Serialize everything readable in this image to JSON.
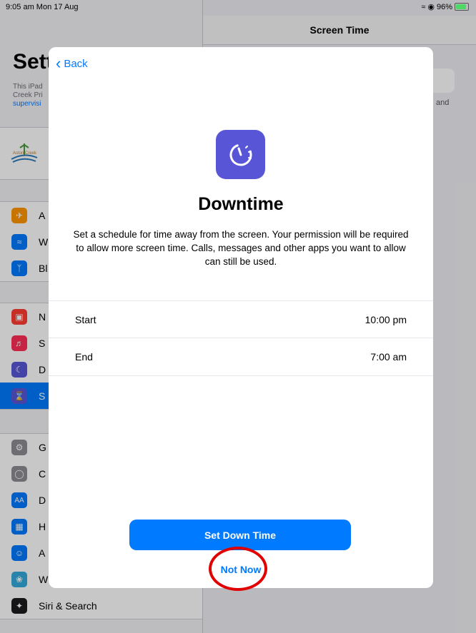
{
  "status_bar": {
    "time": "9:05 am  Mon 17 Aug",
    "battery": "96%"
  },
  "sidebar": {
    "title": "Sett",
    "subtitle_lines": [
      "This iPad",
      "Creek Pri"
    ],
    "supervised_link": "supervisi",
    "items": [
      {
        "label": "A",
        "icon": "airplane-icon",
        "color": "#ff9500"
      },
      {
        "label": "W",
        "icon": "wifi-icon",
        "color": "#007aff"
      },
      {
        "label": "Bl",
        "icon": "bluetooth-icon",
        "color": "#007aff"
      },
      {
        "label": "N",
        "icon": "notifications-icon",
        "color": "#ff3b30"
      },
      {
        "label": "S",
        "icon": "sounds-icon",
        "color": "#ff2d55"
      },
      {
        "label": "D",
        "icon": "moon-icon",
        "color": "#5856d6"
      },
      {
        "label": "S",
        "icon": "hourglass-icon",
        "color": "#5856d6"
      },
      {
        "label": "G",
        "icon": "gear-icon",
        "color": "#8e8e93"
      },
      {
        "label": "C",
        "icon": "control-centre-icon",
        "color": "#8e8e93"
      },
      {
        "label": "D",
        "icon": "display-icon",
        "color": "#007aff"
      },
      {
        "label": "H",
        "icon": "home-screen-icon",
        "color": "#007aff"
      },
      {
        "label": "A",
        "icon": "accessibility-icon",
        "color": "#007aff"
      },
      {
        "label": "W",
        "icon": "wallpaper-icon",
        "color": "#34aadc"
      },
      {
        "label": "Siri & Search",
        "icon": "siri-icon",
        "color": "#1c1c1e"
      }
    ]
  },
  "detail": {
    "title": "Screen Time",
    "snippet": "and"
  },
  "modal": {
    "back_label": "Back",
    "title": "Downtime",
    "description": "Set a schedule for time away from the screen. Your permission will be required to allow more screen time. Calls, messages and other apps you want to allow can still be used.",
    "start_label": "Start",
    "start_value": "10:00 pm",
    "end_label": "End",
    "end_value": "7:00 am",
    "primary_button": "Set Down Time",
    "secondary_button": "Not Now"
  },
  "colors": {
    "accent": "#007aff",
    "downtime_icon": "#5856d6",
    "highlight": "#e00000"
  }
}
